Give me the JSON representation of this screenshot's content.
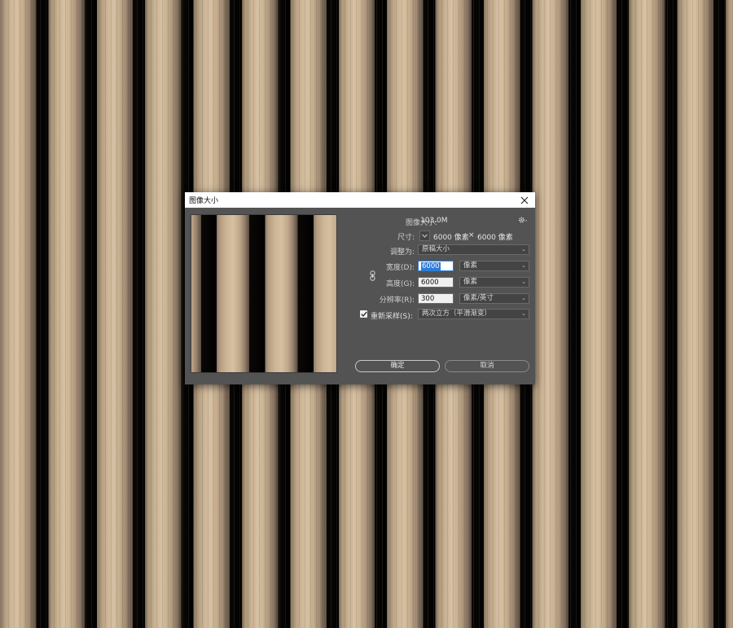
{
  "dialog": {
    "title": "图像大小",
    "image_size_label": "图像大小:",
    "image_size_value": "103.0M",
    "dimensions_label": "尺寸:",
    "dimensions_width": "6000 像素",
    "dimensions_sep": "×",
    "dimensions_height": "6000 像素",
    "fit_to_label": "调整为:",
    "fit_to_value": "原稿大小",
    "width_label": "宽度(D):",
    "width_value": "6000",
    "width_unit": "像素",
    "height_label": "高度(G):",
    "height_value": "6000",
    "height_unit": "像素",
    "resolution_label": "分辨率(R):",
    "resolution_value": "300",
    "resolution_unit": "像素/英寸",
    "resample_label": "重新采样(S):",
    "resample_checked": true,
    "resample_value": "两次立方（平滑渐变）",
    "ok_label": "确定",
    "cancel_label": "取消",
    "icons": {
      "close": "close-icon",
      "settings": "gear-icon",
      "dimensions_toggle": "chevron-down-icon",
      "constrain": "link-icon"
    },
    "colors": {
      "dialog_bg": "#535353",
      "focus_accent": "#2d7bd6"
    }
  }
}
